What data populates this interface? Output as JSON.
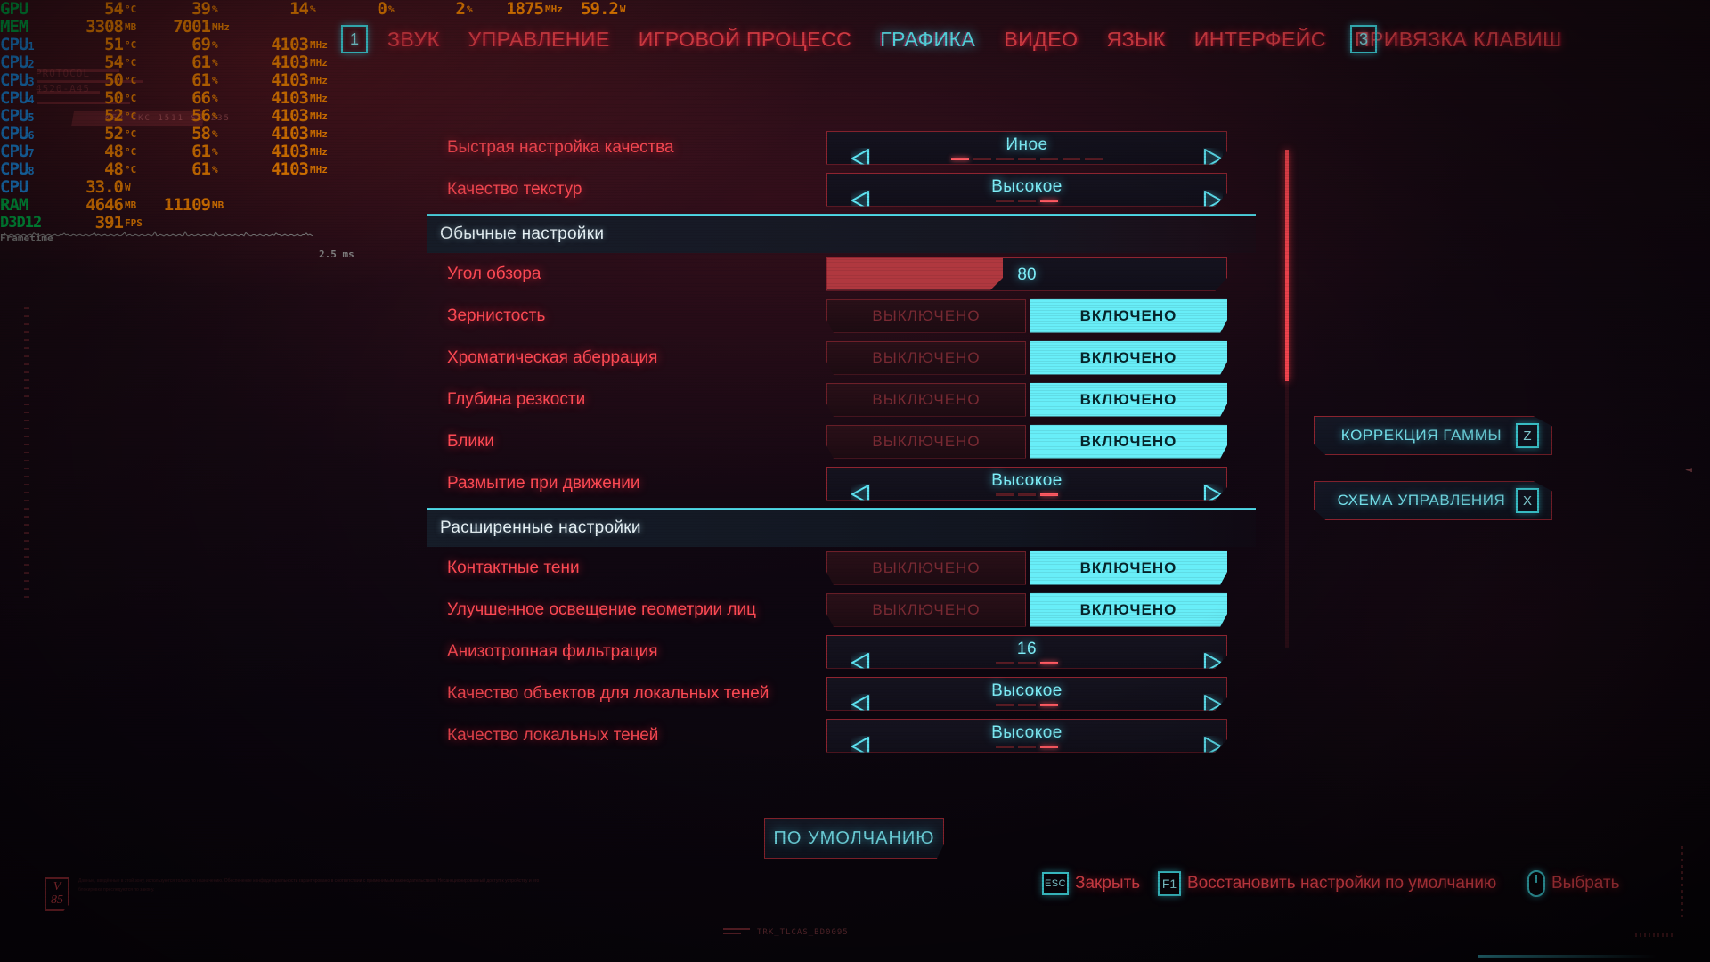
{
  "osd": {
    "rows": [
      {
        "label": "GPU",
        "sub": "",
        "type": "gpu",
        "values": [
          {
            "v": "54",
            "u": "°C"
          },
          {
            "v": "39",
            "u": "%"
          },
          {
            "v": "14",
            "u": "%"
          },
          {
            "v": "0",
            "u": "%"
          },
          {
            "v": "2",
            "u": "%"
          },
          {
            "v": "1875",
            "u": "MHz"
          },
          {
            "v": "59.2",
            "u": "W"
          }
        ]
      },
      {
        "label": "MEM",
        "sub": "",
        "type": "gpu",
        "values": [
          {
            "v": "3308",
            "u": "MB"
          },
          {
            "v": "7001",
            "u": "MHz"
          }
        ]
      },
      {
        "label": "CPU",
        "sub": "1",
        "type": "cpu",
        "values": [
          {
            "v": "51",
            "u": "°C"
          },
          {
            "v": "69",
            "u": "%"
          },
          {
            "v": "4103",
            "u": "MHz"
          }
        ]
      },
      {
        "label": "CPU",
        "sub": "2",
        "type": "cpu",
        "values": [
          {
            "v": "54",
            "u": "°C"
          },
          {
            "v": "61",
            "u": "%"
          },
          {
            "v": "4103",
            "u": "MHz"
          }
        ]
      },
      {
        "label": "CPU",
        "sub": "3",
        "type": "cpu",
        "values": [
          {
            "v": "50",
            "u": "°C"
          },
          {
            "v": "61",
            "u": "%"
          },
          {
            "v": "4103",
            "u": "MHz"
          }
        ]
      },
      {
        "label": "CPU",
        "sub": "4",
        "type": "cpu",
        "values": [
          {
            "v": "50",
            "u": "°C"
          },
          {
            "v": "66",
            "u": "%"
          },
          {
            "v": "4103",
            "u": "MHz"
          }
        ]
      },
      {
        "label": "CPU",
        "sub": "5",
        "type": "cpu",
        "values": [
          {
            "v": "52",
            "u": "°C"
          },
          {
            "v": "56",
            "u": "%"
          },
          {
            "v": "4103",
            "u": "MHz"
          }
        ]
      },
      {
        "label": "CPU",
        "sub": "6",
        "type": "cpu",
        "values": [
          {
            "v": "52",
            "u": "°C"
          },
          {
            "v": "58",
            "u": "%"
          },
          {
            "v": "4103",
            "u": "MHz"
          }
        ]
      },
      {
        "label": "CPU",
        "sub": "7",
        "type": "cpu",
        "values": [
          {
            "v": "48",
            "u": "°C"
          },
          {
            "v": "61",
            "u": "%"
          },
          {
            "v": "4103",
            "u": "MHz"
          }
        ]
      },
      {
        "label": "CPU",
        "sub": "8",
        "type": "cpu",
        "values": [
          {
            "v": "48",
            "u": "°C"
          },
          {
            "v": "61",
            "u": "%"
          },
          {
            "v": "4103",
            "u": "MHz"
          }
        ]
      },
      {
        "label": "CPU",
        "sub": "",
        "type": "cpu",
        "values": [
          {
            "v": "33.0",
            "u": "W"
          }
        ]
      },
      {
        "label": "RAM",
        "sub": "",
        "type": "gpu",
        "values": [
          {
            "v": "4646",
            "u": "MB"
          },
          {
            "v": "11109",
            "u": "MB"
          }
        ]
      },
      {
        "label": "D3D12",
        "sub": "",
        "type": "api",
        "values": [
          {
            "v": "391",
            "u": "FPS"
          }
        ]
      }
    ],
    "frametime_label": "Frametime",
    "frametime_value": "2.5 ms"
  },
  "nav": {
    "left_key": "1",
    "right_key": "3",
    "tabs": [
      {
        "label": "ЗВУК",
        "active": false
      },
      {
        "label": "УПРАВЛЕНИЕ",
        "active": false
      },
      {
        "label": "ИГРОВОЙ ПРОЦЕСС",
        "active": false
      },
      {
        "label": "ГРАФИКА",
        "active": true
      },
      {
        "label": "ВИДЕО",
        "active": false
      },
      {
        "label": "ЯЗЫК",
        "active": false
      },
      {
        "label": "ИНТЕРФЕЙС",
        "active": false
      },
      {
        "label": "ПРИВЯЗКА КЛАВИШ",
        "active": false
      }
    ]
  },
  "settings": [
    {
      "kind": "spinner",
      "label": "Быстрая настройка качества",
      "value": "Иное",
      "segments": 7,
      "active_segment": 1
    },
    {
      "kind": "spinner",
      "label": "Качество текстур",
      "value": "Высокое",
      "segments": 3,
      "active_segment": 3
    },
    {
      "kind": "section",
      "label": "Обычные настройки"
    },
    {
      "kind": "slider",
      "label": "Угол обзора",
      "value": "80",
      "fill_percent": 44
    },
    {
      "kind": "toggle",
      "label": "Зернистость",
      "off_label": "ВЫКЛЮЧЕНО",
      "on_label": "ВКЛЮЧЕНО",
      "state": "on"
    },
    {
      "kind": "toggle",
      "label": "Хроматическая аберрация",
      "off_label": "ВЫКЛЮЧЕНО",
      "on_label": "ВКЛЮЧЕНО",
      "state": "on"
    },
    {
      "kind": "toggle",
      "label": "Глубина резкости",
      "off_label": "ВЫКЛЮЧЕНО",
      "on_label": "ВКЛЮЧЕНО",
      "state": "on"
    },
    {
      "kind": "toggle",
      "label": "Блики",
      "off_label": "ВЫКЛЮЧЕНО",
      "on_label": "ВКЛЮЧЕНО",
      "state": "on"
    },
    {
      "kind": "spinner",
      "label": "Размытие при движении",
      "value": "Высокое",
      "segments": 3,
      "active_segment": 3
    },
    {
      "kind": "section",
      "label": "Расширенные настройки"
    },
    {
      "kind": "toggle",
      "label": "Контактные тени",
      "off_label": "ВЫКЛЮЧЕНО",
      "on_label": "ВКЛЮЧЕНО",
      "state": "on"
    },
    {
      "kind": "toggle",
      "label": "Улучшенное освещение геометрии лиц",
      "off_label": "ВЫКЛЮЧЕНО",
      "on_label": "ВКЛЮЧЕНО",
      "state": "on"
    },
    {
      "kind": "spinner",
      "label": "Анизотропная фильтрация",
      "value": "16",
      "segments": 3,
      "active_segment": 3
    },
    {
      "kind": "spinner",
      "label": "Качество объектов для локальных теней",
      "value": "Высокое",
      "segments": 3,
      "active_segment": 3
    },
    {
      "kind": "spinner",
      "label": "Качество локальных теней",
      "value": "Высокое",
      "segments": 3,
      "active_segment": 3
    }
  ],
  "side_buttons": [
    {
      "label": "КОРРЕКЦИЯ ГАММЫ",
      "key": "Z"
    },
    {
      "label": "СХЕМА УПРАВЛЕНИЯ",
      "key": "X"
    }
  ],
  "default_button": "ПО УМОЛЧАНИЮ",
  "footer": [
    {
      "key": "ESC",
      "label": "Закрыть",
      "icon": "key"
    },
    {
      "key": "F1",
      "label": "Восстановить настройки по умолчанию",
      "icon": "key"
    },
    {
      "key": "",
      "label": "Выбрать",
      "icon": "mouse"
    }
  ],
  "version_badge": {
    "v": "V",
    "num": "85"
  },
  "decor": {
    "protocol": "PROTOCOL\n4520-A45",
    "code": "KF2 CKC 1511 SS-235",
    "bottom_mark": "TRK_TLCAS_BD0095",
    "arrow": "◄",
    "legal_text": "Данные, введённые в этой зону, используются только по назначению. Обеспечение конфиденциальности гарантировано в соответствии с применимым законодательством. Несанкционированный доступ к устройству и его блокировка преследуются по закону."
  },
  "colors": {
    "accent_red": "#ff4a54",
    "accent_cyan": "#7bedf8",
    "toggle_on_bg": "#68eef8",
    "panel_border": "#8f2430",
    "osd_value": "#ff8800",
    "osd_gpu_label": "#00b84a",
    "osd_cpu_label": "#2196f3"
  }
}
